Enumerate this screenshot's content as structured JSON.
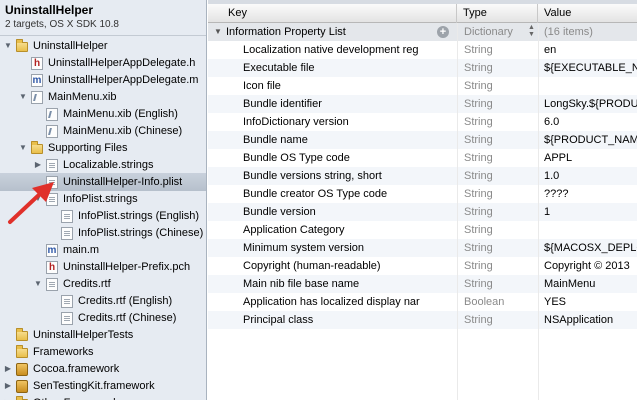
{
  "project": {
    "title": "UninstallHelper",
    "subtitle": "2 targets, OS X SDK 10.8"
  },
  "navigator": [
    {
      "label": "UninstallHelper",
      "icon": "folder-icon",
      "indent": 0,
      "tri": "open"
    },
    {
      "label": "UninstallHelperAppDelegate.h",
      "icon": "header-file-icon",
      "indent": 1,
      "tri": ""
    },
    {
      "label": "UninstallHelperAppDelegate.m",
      "icon": "source-file-icon",
      "indent": 1,
      "tri": ""
    },
    {
      "label": "MainMenu.xib",
      "icon": "xib-file-icon",
      "indent": 1,
      "tri": "open"
    },
    {
      "label": "MainMenu.xib (English)",
      "icon": "xib-file-icon",
      "indent": 2,
      "tri": ""
    },
    {
      "label": "MainMenu.xib (Chinese)",
      "icon": "xib-file-icon",
      "indent": 2,
      "tri": ""
    },
    {
      "label": "Supporting Files",
      "icon": "folder-icon",
      "indent": 1,
      "tri": "open"
    },
    {
      "label": "Localizable.strings",
      "icon": "strings-file-icon",
      "indent": 2,
      "tri": "closed"
    },
    {
      "label": "UninstallHelper-Info.plist",
      "icon": "plist-file-icon",
      "indent": 2,
      "tri": "",
      "selected": true
    },
    {
      "label": "InfoPlist.strings",
      "icon": "strings-file-icon",
      "indent": 2,
      "tri": "open"
    },
    {
      "label": "InfoPlist.strings (English)",
      "icon": "strings-file-icon",
      "indent": 3,
      "tri": ""
    },
    {
      "label": "InfoPlist.strings (Chinese)",
      "icon": "strings-file-icon",
      "indent": 3,
      "tri": ""
    },
    {
      "label": "main.m",
      "icon": "source-file-icon",
      "indent": 2,
      "tri": ""
    },
    {
      "label": "UninstallHelper-Prefix.pch",
      "icon": "header-file-icon",
      "indent": 2,
      "tri": ""
    },
    {
      "label": "Credits.rtf",
      "icon": "rtf-file-icon",
      "indent": 2,
      "tri": "open"
    },
    {
      "label": "Credits.rtf (English)",
      "icon": "rtf-file-icon",
      "indent": 3,
      "tri": ""
    },
    {
      "label": "Credits.rtf (Chinese)",
      "icon": "rtf-file-icon",
      "indent": 3,
      "tri": ""
    },
    {
      "label": "UninstallHelperTests",
      "icon": "folder-icon",
      "indent": 0,
      "tri": ""
    },
    {
      "label": "Frameworks",
      "icon": "folder-icon",
      "indent": 0,
      "tri": ""
    },
    {
      "label": "Cocoa.framework",
      "icon": "framework-icon",
      "indent": 0,
      "tri": "closed"
    },
    {
      "label": "SenTestingKit.framework",
      "icon": "framework-icon",
      "indent": 0,
      "tri": "closed"
    },
    {
      "label": "Other Frameworks",
      "icon": "folder-icon",
      "indent": 0,
      "tri": "closed"
    }
  ],
  "plist": {
    "headers": {
      "key": "Key",
      "type": "Type",
      "value": "Value"
    },
    "root": {
      "key": "Information Property List",
      "type": "Dictionary",
      "value": "(16 items)"
    },
    "rows": [
      {
        "key": "Localization native development reg",
        "type": "String",
        "value": "en"
      },
      {
        "key": "Executable file",
        "type": "String",
        "value": "${EXECUTABLE_NAME}"
      },
      {
        "key": "Icon file",
        "type": "String",
        "value": ""
      },
      {
        "key": "Bundle identifier",
        "type": "String",
        "value": "LongSky.${PRODUCT_NAME}"
      },
      {
        "key": "InfoDictionary version",
        "type": "String",
        "value": "6.0"
      },
      {
        "key": "Bundle name",
        "type": "String",
        "value": "${PRODUCT_NAME}"
      },
      {
        "key": "Bundle OS Type code",
        "type": "String",
        "value": "APPL"
      },
      {
        "key": "Bundle versions string, short",
        "type": "String",
        "value": "1.0"
      },
      {
        "key": "Bundle creator OS Type code",
        "type": "String",
        "value": "????"
      },
      {
        "key": "Bundle version",
        "type": "String",
        "value": "1"
      },
      {
        "key": "Application Category",
        "type": "String",
        "value": ""
      },
      {
        "key": "Minimum system version",
        "type": "String",
        "value": "${MACOSX_DEPLOYMENT_TARGET}"
      },
      {
        "key": "Copyright (human-readable)",
        "type": "String",
        "value": "Copyright © 2013"
      },
      {
        "key": "Main nib file base name",
        "type": "String",
        "value": "MainMenu"
      },
      {
        "key": "Application has localized display nar",
        "type": "Boolean",
        "value": "YES"
      },
      {
        "key": "Principal class",
        "type": "String",
        "value": "NSApplication"
      }
    ]
  },
  "colors": {
    "selection": "#b9c3cf",
    "arrow": "#e0302a",
    "sidebar": "#e6ebf2"
  }
}
